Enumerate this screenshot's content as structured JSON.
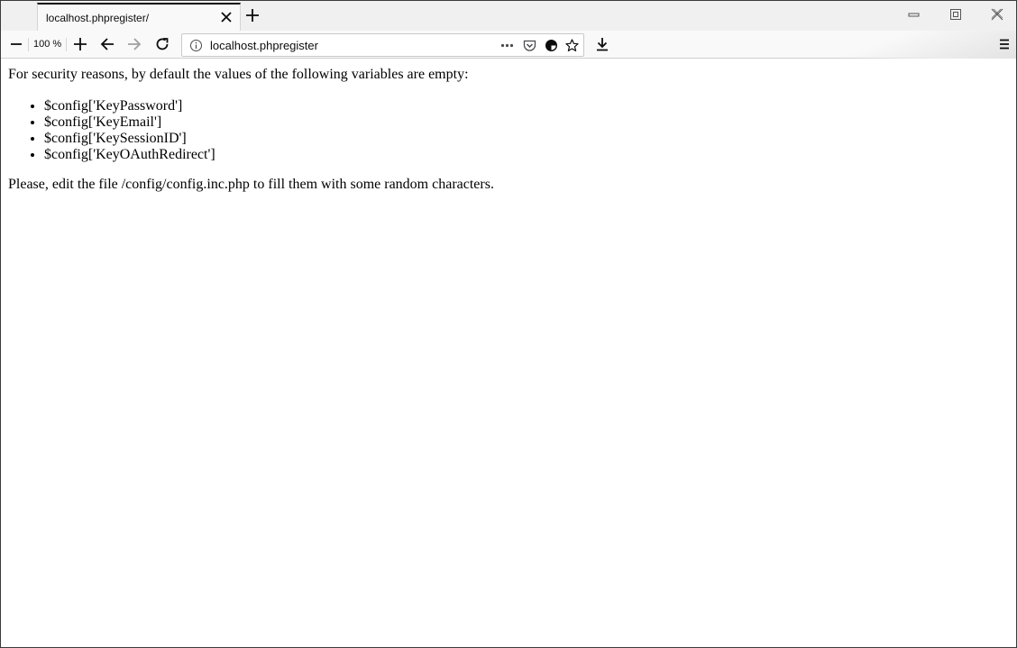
{
  "browser": {
    "tab": {
      "title": "localhost.phpregister/"
    },
    "zoom_level": "100 %",
    "url": "localhost.phpregister",
    "icons": {
      "tab_close": "close-icon",
      "new_tab": "plus-icon",
      "minimize": "minimize-icon",
      "restore": "restore-icon",
      "window_close": "close-icon",
      "zoom_out": "minus-icon",
      "zoom_in": "plus-icon",
      "back": "arrow-left-icon",
      "forward": "arrow-right-icon",
      "reload": "reload-icon",
      "site_info": "info-icon",
      "page_actions": "ellipsis-icon",
      "pocket": "pocket-icon",
      "tracking": "tracking-protection-icon",
      "bookmark": "star-icon",
      "downloads": "download-icon",
      "menu": "hamburger-icon"
    }
  },
  "page": {
    "intro": "For security reasons, by default the values of the following variables are empty:",
    "variables": [
      "$config['KeyPassword']",
      "$config['KeyEmail']",
      "$config['KeySessionID']",
      "$config['KeyOAuthRedirect']"
    ],
    "instruction": "Please, edit the file /config/config.inc.php to fill them with some random characters."
  }
}
